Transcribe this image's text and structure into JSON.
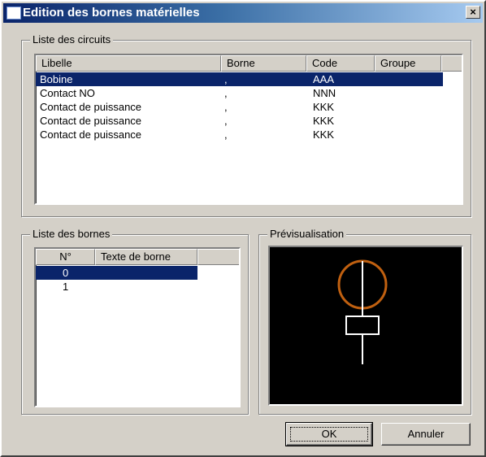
{
  "window": {
    "title": "Edition des bornes matérielles",
    "close_label": "×"
  },
  "circuits": {
    "legend": "Liste des circuits",
    "columns": [
      "Libelle",
      "Borne",
      "Code",
      "Groupe"
    ],
    "rows": [
      {
        "libelle": "Bobine",
        "borne": ",",
        "code": "AAA",
        "groupe": "",
        "selected": true
      },
      {
        "libelle": "Contact NO",
        "borne": ",",
        "code": "NNN",
        "groupe": "",
        "selected": false
      },
      {
        "libelle": "Contact de puissance",
        "borne": ",",
        "code": "KKK",
        "groupe": "",
        "selected": false
      },
      {
        "libelle": "Contact de puissance",
        "borne": ",",
        "code": "KKK",
        "groupe": "",
        "selected": false
      },
      {
        "libelle": "Contact de puissance",
        "borne": ",",
        "code": "KKK",
        "groupe": "",
        "selected": false
      }
    ]
  },
  "bornes": {
    "legend": "Liste des bornes",
    "columns": [
      "N°",
      "Texte de borne"
    ],
    "rows": [
      {
        "numero": "0",
        "texte": "",
        "selected": true
      },
      {
        "numero": "1",
        "texte": "",
        "selected": false
      }
    ]
  },
  "preview": {
    "legend": "Prévisualisation",
    "background_color": "#000000",
    "circle_color": "#c06010",
    "line_color": "#ffffff"
  },
  "buttons": {
    "ok": "OK",
    "cancel": "Annuler"
  },
  "colors": {
    "selection": "#0a246a",
    "face": "#d4d0c8"
  }
}
